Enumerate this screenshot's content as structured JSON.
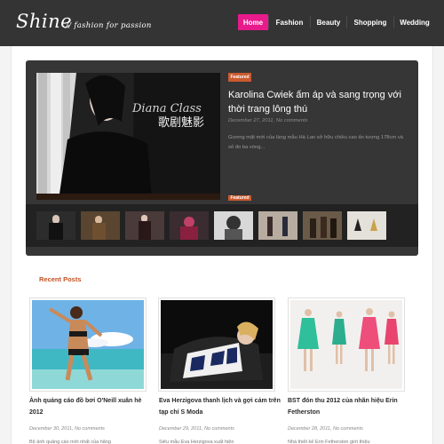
{
  "header": {
    "logo": "Shine",
    "tagline": "// fashion for passion",
    "nav": [
      {
        "label": "Home",
        "active": true
      },
      {
        "label": "Fashion",
        "active": false
      },
      {
        "label": "Beauty",
        "active": false
      },
      {
        "label": "Shopping",
        "active": false
      },
      {
        "label": "Wedding",
        "active": false
      }
    ]
  },
  "slider": {
    "badge": "Featured",
    "title": "Karolina Cwiek ấm áp và sang trọng với thời trang lông thú",
    "date": "December 27, 2011, No comments",
    "excerpt": "Gương mặt mới của làng mẫu Hà Lan sở hữu chiều cao ấn tượng 178cm và số đo ba vòng...",
    "image_caption_en": "Diana Class",
    "image_caption_cn": "歌剧魅影",
    "next_badge": "Featured"
  },
  "recent_posts": {
    "section_title": "Recent Posts",
    "posts": [
      {
        "title": "Ảnh quảng cáo đồ bơi O'Neill xuân hè 2012",
        "date": "December 30, 2011, No comments",
        "excerpt": "Bộ ảnh quảng cáo mới nhất của hãng"
      },
      {
        "title": "Eva Herzigova thanh lịch và gợi cảm trên tạp chí S Moda",
        "date": "December 29, 2011, No comments",
        "excerpt": "Siêu mẫu Eva Herzigova xuất hiện"
      },
      {
        "title": "BST đón thu 2012 của nhãn hiệu Erin Fetherston",
        "date": "December 28, 2011, No comments",
        "excerpt": "Nhà thiết kế Erin Fetherston giới thiệu"
      }
    ]
  },
  "colors": {
    "header_bg": "#343434",
    "nav_active": "#e81b8c",
    "accent": "#c55223",
    "slider_bg": "#363636"
  }
}
